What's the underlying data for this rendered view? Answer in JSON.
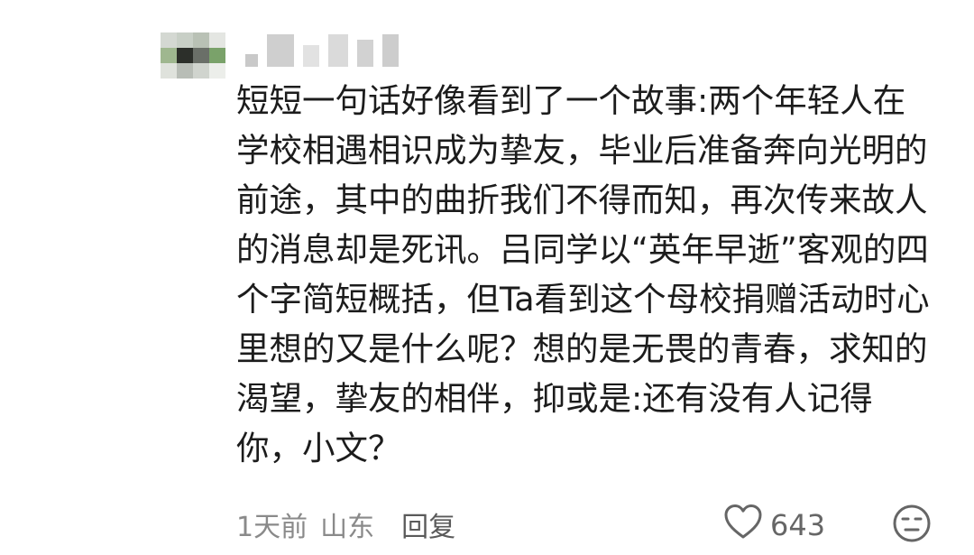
{
  "comment": {
    "text": "短短一句话好像看到了一个故事:两个年轻人在学校相遇相识成为挚友，毕业后准备奔向光明的前途，其中的曲折我们不得而知，再次传来故人的消息却是死讯。吕同学以“英年早逝”客观的四个字简短概括，但Ta看到这个母校捐赠活动时心里想的又是什么呢？想的是无畏的青春，求知的渴望，挚友的相伴，抑或是:还有没有人记得你，小文？",
    "time": "1天前",
    "location": "山东",
    "reply_label": "回复",
    "like_count": "643"
  },
  "icons": {
    "like": "heart-outline-icon",
    "reaction": "neutral-face-icon"
  },
  "colors": {
    "text": "#1c1c1c",
    "meta": "#8a8a8a",
    "icon": "#666666"
  }
}
